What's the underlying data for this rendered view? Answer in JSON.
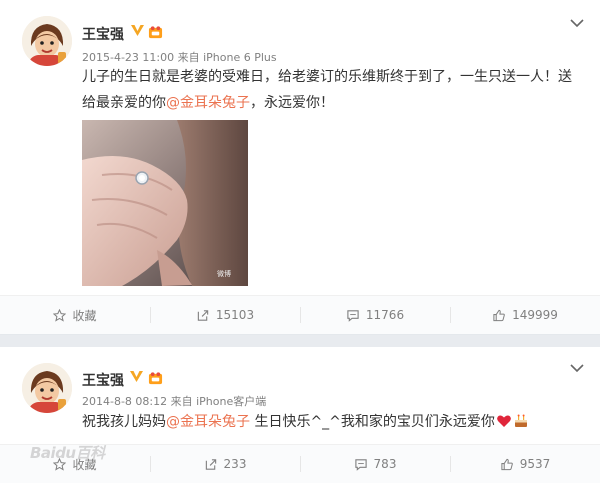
{
  "post1": {
    "username": "王宝强",
    "meta": "2015-4-23 11:00 来自 iPhone 6 Plus",
    "text_before": "儿子的生日就是老婆的受难日，给老婆订的乐维斯终于到了，一生只送一人！送给最亲爱的你",
    "mention": "@金耳朵兔子",
    "text_after": "，永远爱你！",
    "photo_caption": "微博",
    "actions": {
      "favorite": "收藏",
      "repost": "15103",
      "comment": "11766",
      "like": "149999"
    }
  },
  "post2": {
    "username": "王宝强",
    "meta": "2014-8-8 08:12 来自 iPhone客户端",
    "text_before": "祝我孩儿妈妈",
    "mention": "@金耳朵兔子",
    "text_after": " 生日快乐^_^我和家的宝贝们永远爱你",
    "actions": {
      "favorite": "收藏",
      "repost": "233",
      "comment": "783",
      "like": "9537"
    }
  },
  "watermark": "Baidu百科",
  "colors": {
    "mention": "#eb7350",
    "background": "#e8ebef",
    "vip_badge": "#f5a623"
  }
}
